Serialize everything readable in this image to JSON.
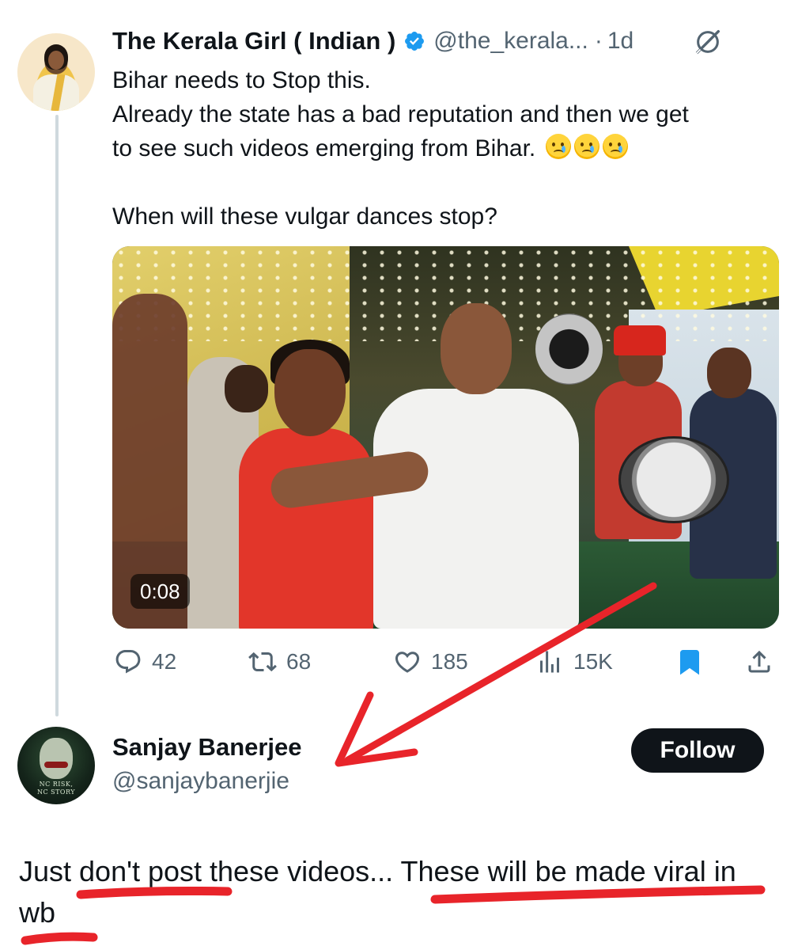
{
  "tweet": {
    "author_name": "The Kerala Girl ( Indian )",
    "handle": "@the_kerala...",
    "separator": "·",
    "time": "1d",
    "lines": [
      "Bihar needs to Stop this.",
      "Already the state has a bad reputation and then we get",
      "to see such videos emerging from Bihar."
    ],
    "question": "When will these vulgar dances stop?",
    "emoji_icons": [
      "crying-face-icon",
      "crying-face-icon",
      "crying-face-icon"
    ],
    "video": {
      "duration": "0:08"
    },
    "stats": {
      "replies": "42",
      "reposts": "68",
      "likes": "185",
      "views": "15K"
    },
    "bookmarked": true
  },
  "reply": {
    "author_name": "Sanjay Banerjee",
    "handle": "@sanjaybanerjie",
    "follow_label": "Follow",
    "avatar_text": [
      "NC RISK,",
      "NC STORY"
    ],
    "text_parts": [
      "Just ",
      "don't post",
      " these videos... ",
      "These will be made viral",
      " ",
      "in wb"
    ]
  },
  "colors": {
    "text_primary": "#0f1419",
    "text_secondary": "#536471",
    "verified_blue": "#1d9bf0",
    "bookmark_blue": "#1d9bf0",
    "annotation_red": "#e8242a",
    "thread_line": "#cfd9de",
    "follow_button_bg": "#0f1419"
  }
}
